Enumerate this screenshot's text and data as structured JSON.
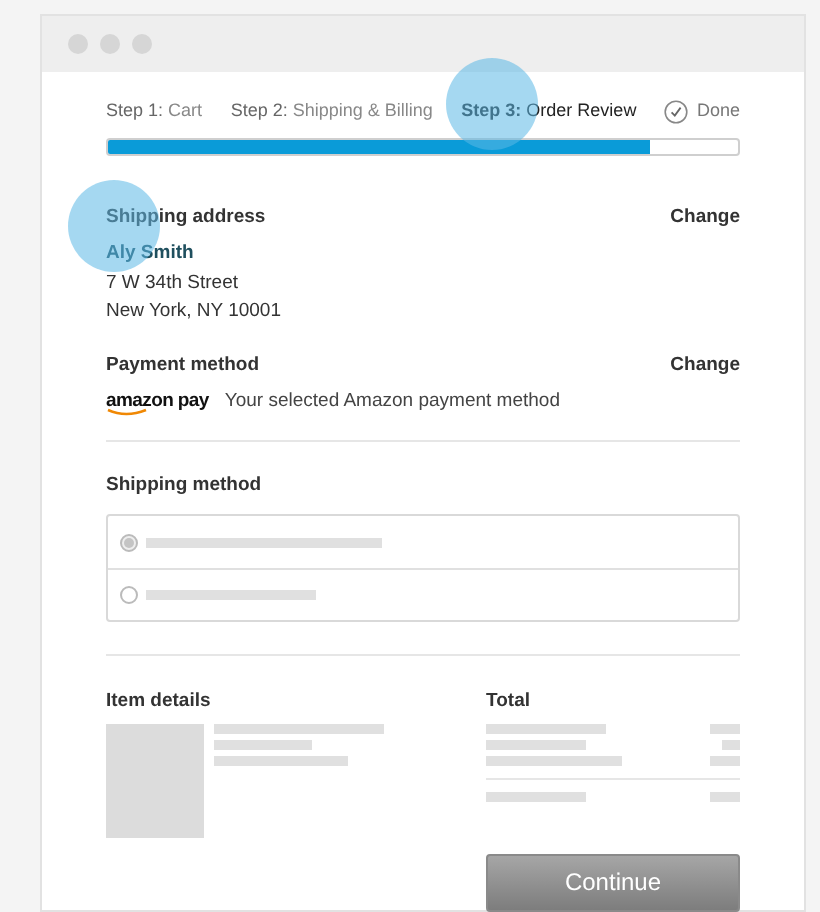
{
  "steps": [
    {
      "label": "**Step 1:** Cart",
      "selected": false,
      "kind": "step"
    },
    {
      "label": "**Step 2:** Shipping & Billing",
      "selected": false,
      "kind": "step"
    },
    {
      "label": "**Step 3:** Order Review",
      "selected": true,
      "kind": "step"
    },
    {
      "label": "Done",
      "selected": false,
      "kind": "done"
    }
  ],
  "progress": {
    "level": 0.86
  },
  "shipping_address": {
    "heading": "Shipping address",
    "action": "Change",
    "name": "Aly Smith",
    "lines": [
      "7 W 34th Street",
      "New York, NY 10001"
    ]
  },
  "payment_method": {
    "heading": "Payment method",
    "action": "Change",
    "logo": "amazon pay",
    "text": "Your selected Amazon payment method"
  },
  "shipping_method": {
    "heading": "Shipping method",
    "options": [
      {
        "selected": true
      },
      {
        "selected": false
      }
    ]
  },
  "item_details": {
    "heading": "Item details"
  },
  "total": {
    "heading": "Total"
  },
  "continue_button": "Continue"
}
